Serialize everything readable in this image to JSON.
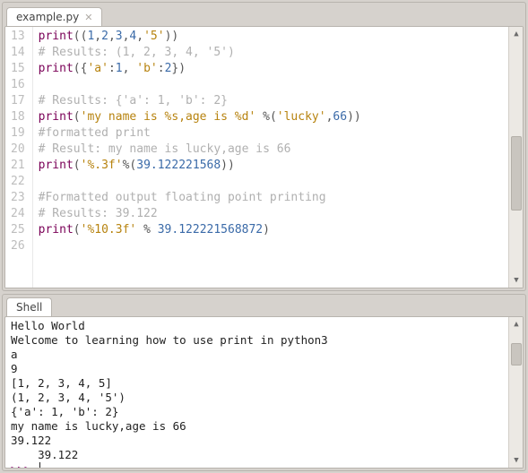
{
  "editor": {
    "tab_label": "example.py",
    "first_line_no": 13,
    "lines": [
      {
        "tokens": [
          {
            "t": "func",
            "v": "print"
          },
          {
            "t": "bracket",
            "v": "(("
          },
          {
            "t": "num",
            "v": "1"
          },
          {
            "t": "op",
            "v": ","
          },
          {
            "t": "num",
            "v": "2"
          },
          {
            "t": "op",
            "v": ","
          },
          {
            "t": "num",
            "v": "3"
          },
          {
            "t": "op",
            "v": ","
          },
          {
            "t": "num",
            "v": "4"
          },
          {
            "t": "op",
            "v": ","
          },
          {
            "t": "str",
            "v": "'5'"
          },
          {
            "t": "bracket",
            "v": "))"
          }
        ]
      },
      {
        "tokens": [
          {
            "t": "comment",
            "v": "# Results: (1, 2, 3, 4, '5')"
          }
        ]
      },
      {
        "tokens": [
          {
            "t": "func",
            "v": "print"
          },
          {
            "t": "bracket",
            "v": "({"
          },
          {
            "t": "str",
            "v": "'a'"
          },
          {
            "t": "op",
            "v": ":"
          },
          {
            "t": "num",
            "v": "1"
          },
          {
            "t": "op",
            "v": ", "
          },
          {
            "t": "str",
            "v": "'b'"
          },
          {
            "t": "op",
            "v": ":"
          },
          {
            "t": "num",
            "v": "2"
          },
          {
            "t": "bracket",
            "v": "})"
          }
        ]
      },
      {
        "tokens": []
      },
      {
        "tokens": [
          {
            "t": "comment",
            "v": "# Results: {'a': 1, 'b': 2}"
          }
        ]
      },
      {
        "tokens": [
          {
            "t": "func",
            "v": "print"
          },
          {
            "t": "bracket",
            "v": "("
          },
          {
            "t": "str",
            "v": "'my name is %s,age is %d'"
          },
          {
            "t": "op",
            "v": " %"
          },
          {
            "t": "bracket",
            "v": "("
          },
          {
            "t": "str",
            "v": "'lucky'"
          },
          {
            "t": "op",
            "v": ","
          },
          {
            "t": "num",
            "v": "66"
          },
          {
            "t": "bracket",
            "v": "))"
          }
        ]
      },
      {
        "tokens": [
          {
            "t": "comment",
            "v": "#formatted print"
          }
        ]
      },
      {
        "tokens": [
          {
            "t": "comment",
            "v": "# Result: my name is lucky,age is 66"
          }
        ]
      },
      {
        "tokens": [
          {
            "t": "func",
            "v": "print"
          },
          {
            "t": "bracket",
            "v": "("
          },
          {
            "t": "str",
            "v": "'%.3f'"
          },
          {
            "t": "op",
            "v": "%"
          },
          {
            "t": "bracket",
            "v": "("
          },
          {
            "t": "num",
            "v": "39.122221568"
          },
          {
            "t": "bracket",
            "v": "))"
          }
        ]
      },
      {
        "tokens": []
      },
      {
        "tokens": [
          {
            "t": "comment",
            "v": "#Formatted output floating point printing"
          }
        ]
      },
      {
        "tokens": [
          {
            "t": "comment",
            "v": "# Results: 39.122"
          }
        ]
      },
      {
        "tokens": [
          {
            "t": "func",
            "v": "print"
          },
          {
            "t": "bracket",
            "v": "("
          },
          {
            "t": "str",
            "v": "'%10.3f'"
          },
          {
            "t": "op",
            "v": " % "
          },
          {
            "t": "num",
            "v": "39.122221568872"
          },
          {
            "t": "bracket",
            "v": ")"
          }
        ]
      },
      {
        "tokens": []
      }
    ],
    "scroll": {
      "thumb_top_pct": 60,
      "thumb_height_pct": 32
    }
  },
  "shell": {
    "tab_label": "Shell",
    "output_lines": [
      "Hello World",
      "Welcome to learning how to use print in python3",
      "a",
      "9",
      "[1, 2, 3, 4, 5]",
      "(1, 2, 3, 4, '5')",
      "{'a': 1, 'b': 2}",
      "my name is lucky,age is 66",
      "39.122",
      "    39.122"
    ],
    "prompt": ">>> ",
    "scroll": {
      "thumb_top_pct": 12,
      "thumb_height_pct": 18
    }
  }
}
